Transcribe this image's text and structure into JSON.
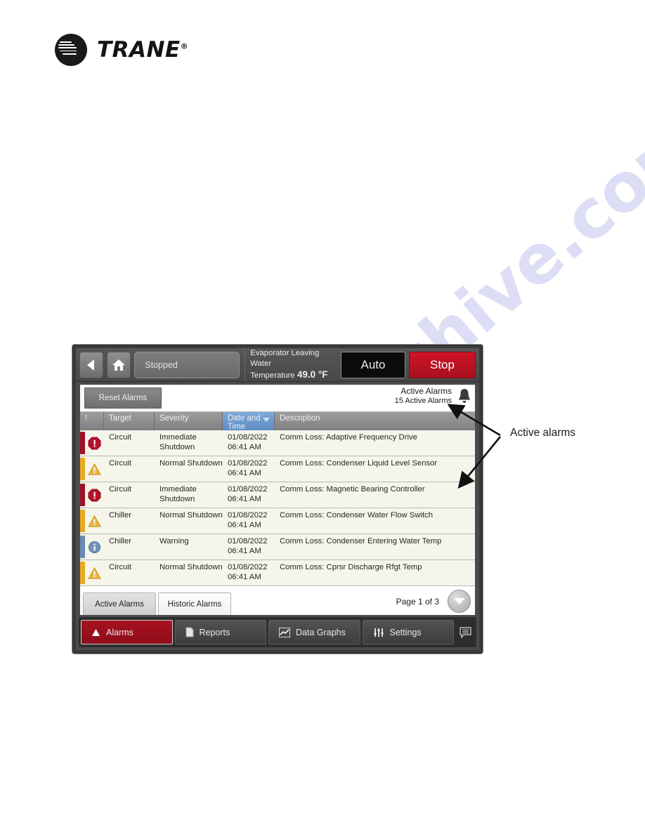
{
  "brand": {
    "name": "TRANE",
    "trademark": "®"
  },
  "annotation": {
    "label": "Active alarms"
  },
  "watermark": {
    "text": "manualsarchive.com"
  },
  "topbar": {
    "back_icon": "back-arrow-icon",
    "home_icon": "home-icon",
    "status_value": "Stopped",
    "evaporator_label_line1": "Evaporator Leaving Water",
    "evaporator_label_line2": "Temperature",
    "evaporator_temp": "49.0 °F",
    "mode_label": "Auto",
    "stop_label": "Stop",
    "stop_color": "#c31424",
    "mode_bg": "#0b0b0b"
  },
  "content_header": {
    "reset_label": "Reset Alarms",
    "title": "Active Alarms",
    "count_text": "15 Active Alarms",
    "bell_icon": "bell-icon"
  },
  "table": {
    "columns": [
      {
        "key": "icon",
        "label": "!",
        "sorted": false
      },
      {
        "key": "target",
        "label": "Target",
        "sorted": false
      },
      {
        "key": "severity",
        "label": "Severity",
        "sorted": false
      },
      {
        "key": "datetime",
        "label": "Date and Time",
        "sorted": true
      },
      {
        "key": "description",
        "label": "Description",
        "sorted": false
      }
    ],
    "sort_caret_icon": "chevron-down-icon",
    "rows": [
      {
        "icon": "error-octagon-icon",
        "severity_class": "sev-imm",
        "bar_color": "#9e1226",
        "target": "Circuit",
        "severity": "Immediate Shutdown",
        "date": "01/08/2022",
        "time": "06:41 AM",
        "description": "Comm Loss: Adaptive Frequency Drive"
      },
      {
        "icon": "warning-triangle-icon",
        "severity_class": "sev-norm",
        "bar_color": "#e8a923",
        "target": "Circuit",
        "severity": "Normal Shutdown",
        "date": "01/08/2022",
        "time": "06:41 AM",
        "description": "Comm Loss: Condenser Liquid Level Sensor"
      },
      {
        "icon": "error-octagon-icon",
        "severity_class": "sev-imm",
        "bar_color": "#9e1226",
        "target": "Circuit",
        "severity": "Immediate Shutdown",
        "date": "01/08/2022",
        "time": "06:41 AM",
        "description": "Comm Loss: Magnetic Bearing Controller"
      },
      {
        "icon": "warning-triangle-icon",
        "severity_class": "sev-norm",
        "bar_color": "#e8a923",
        "target": "Chiller",
        "severity": "Normal Shutdown",
        "date": "01/08/2022",
        "time": "06:41 AM",
        "description": "Comm Loss: Condenser Water Flow Switch"
      },
      {
        "icon": "info-circle-icon",
        "severity_class": "sev-warn",
        "bar_color": "#6a8cb3",
        "target": "Chiller",
        "severity": "Warning",
        "date": "01/08/2022",
        "time": "06:41 AM",
        "description": "Comm Loss: Condenser Entering Water Temp"
      },
      {
        "icon": "warning-triangle-icon",
        "severity_class": "sev-norm",
        "bar_color": "#e8a923",
        "target": "Circuit",
        "severity": "Normal Shutdown",
        "date": "01/08/2022",
        "time": "06:41 AM",
        "description": "Comm Loss: Cprsr Discharge Rfgt Temp"
      }
    ]
  },
  "footer": {
    "tabs": [
      {
        "label": "Active Alarms",
        "active": true
      },
      {
        "label": "Historic Alarms",
        "active": false
      }
    ],
    "page_label": "Page 1 of 3",
    "scroll_icon": "chevron-down-icon"
  },
  "navbar": {
    "items": [
      {
        "label": "Alarms",
        "icon": "alarm-triangle-icon",
        "selected": true
      },
      {
        "label": "Reports",
        "icon": "document-icon",
        "selected": false
      },
      {
        "label": "Data Graphs",
        "icon": "line-chart-icon",
        "selected": false
      },
      {
        "label": "Settings",
        "icon": "sliders-icon",
        "selected": false
      }
    ],
    "chat_icon": "speech-bubble-icon"
  }
}
